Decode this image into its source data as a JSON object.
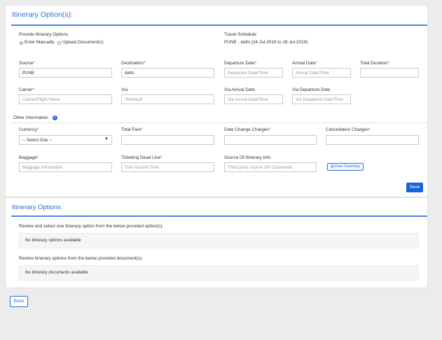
{
  "section1": {
    "title": "Itinerary Option(s):"
  },
  "provide": {
    "label": "Provide Itinerary Options",
    "options": [
      "Enter Manually",
      "Upload Document(s)"
    ],
    "selected": 0
  },
  "schedule": {
    "label": "Travel Schedule",
    "value": "PUNE - delhi (24-Jul-2019 to 26-Jul-2019)"
  },
  "fields": {
    "source": {
      "label": "Source",
      "value": "PUNE"
    },
    "destination": {
      "label": "Destination",
      "value": "delhi"
    },
    "departure_date": {
      "label": "Departure Date",
      "placeholder": "Departure Date/Time"
    },
    "arrival_date": {
      "label": "Arrival Date",
      "placeholder": "Arrival Date/Time"
    },
    "total_duration": {
      "label": "Total Duration",
      "value": ""
    },
    "carrier": {
      "label": "Carrier",
      "placeholder": "Carrier/Flight Name"
    },
    "via": {
      "label": "Via",
      "placeholder": "Via/Hault"
    },
    "via_arrival": {
      "label": "Via Arrival Date",
      "placeholder": "Via Arrival Date/Time"
    },
    "via_departure": {
      "label": "Via Departure Date",
      "placeholder": "Via Departure Date/Time"
    }
  },
  "other": {
    "title": "Other Information",
    "currency": {
      "label": "Currency",
      "selected": "-- Select One --"
    },
    "total_fare": {
      "label": "Total Fare",
      "value": ""
    },
    "date_change": {
      "label": "Date Change Charges",
      "value": ""
    },
    "cancellation": {
      "label": "Cancellation Charges",
      "value": ""
    },
    "baggage": {
      "label": "Baggage",
      "placeholder": "Baggage Information"
    },
    "ticketing": {
      "label": "Ticketing Dead Line",
      "placeholder": "Turn Around Time"
    },
    "source_info": {
      "label": "Source Of Itinerary Info.",
      "placeholder": "Third party source OR Comments"
    },
    "fare_summary_label": "Fare Summary",
    "save_label": "Save"
  },
  "section2": {
    "title": "Itinerary Options",
    "review_options_text": "Review and select one itinerary option from the below provided option(s).",
    "no_options": "No itinerary options available",
    "review_docs_text": "Review itinerary options from the below provided document(s).",
    "no_docs": "No itinerary documents available"
  },
  "back_label": "Back",
  "colors": {
    "accent": "#2d6ed6",
    "primary_button": "#1565d8",
    "required": "#d33333"
  }
}
